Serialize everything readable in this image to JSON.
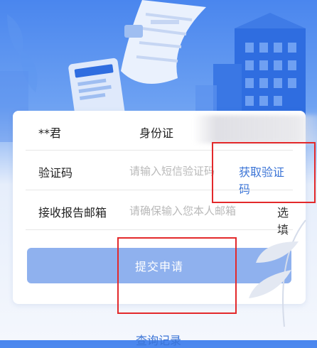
{
  "form": {
    "name_value": "**君",
    "id_label": "身份证",
    "code_label": "验证码",
    "code_placeholder": "请输入短信验证码",
    "get_code_label": "获取验证码",
    "email_label": "接收报告邮箱",
    "email_placeholder": "请确保输入您本人邮箱",
    "optional_label": "选填",
    "submit_label": "提交申请"
  },
  "footer": {
    "query_label": "查询记录"
  },
  "colors": {
    "accent": "#3b74d6",
    "submit_bg": "#8fb1ee",
    "highlight": "#e3292b"
  }
}
